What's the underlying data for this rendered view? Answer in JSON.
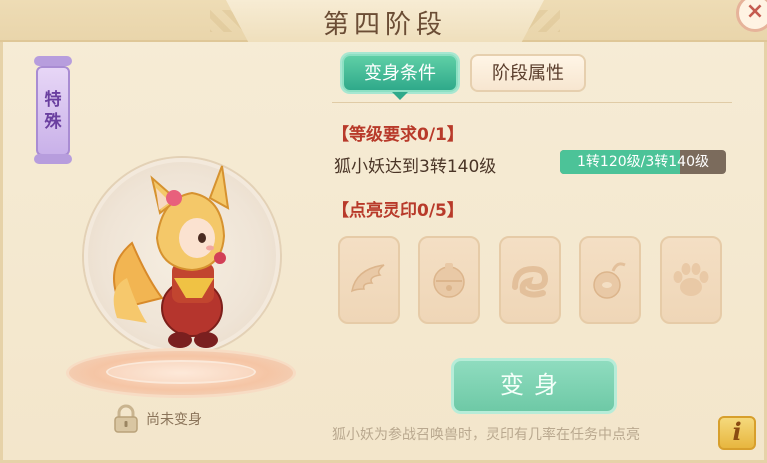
{
  "header": {
    "title": "第四阶段",
    "close_symbol": "×"
  },
  "pet_panel": {
    "tag_chars": [
      "特",
      "殊"
    ],
    "lock_status": "尚未变身"
  },
  "tabs": [
    {
      "label": "变身条件",
      "active": true
    },
    {
      "label": "阶段属性",
      "active": false
    }
  ],
  "level_requirement": {
    "title": "【等级要求0/1】",
    "description": "狐小妖达到3转140级",
    "progress_text": "1转120级/3转140级",
    "progress_fraction": 0.72
  },
  "seal_requirement": {
    "title": "【点亮灵印0/5】",
    "seals": [
      {
        "icon": "wing-icon"
      },
      {
        "icon": "bell-icon"
      },
      {
        "icon": "swirl-icon"
      },
      {
        "icon": "pendant-icon"
      },
      {
        "icon": "paw-icon"
      }
    ]
  },
  "transform_button": "变身",
  "hint": "狐小妖为参战召唤兽时，灵印有几率在任务中点亮",
  "info_button": "i",
  "colors": {
    "accent": "#2fa98a",
    "title_red": "#b83a2a",
    "panel": "#f3e6cb"
  }
}
